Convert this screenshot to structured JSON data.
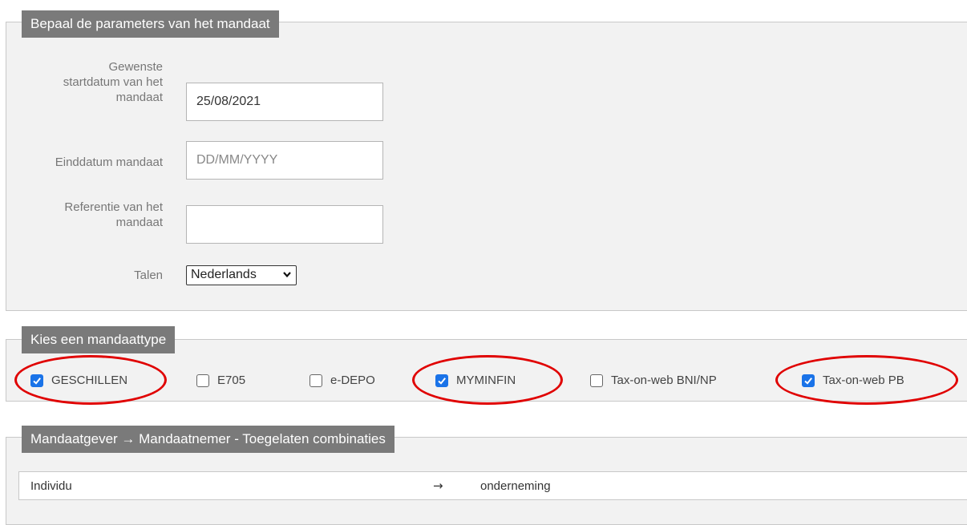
{
  "params": {
    "legend": "Bepaal de parameters van het mandaat",
    "start_label_1": "Gewenste",
    "start_label_2": "startdatum van het",
    "start_label_3": "mandaat",
    "start_value": "25/08/2021",
    "end_label": "Einddatum mandaat",
    "end_placeholder": "DD/MM/YYYY",
    "ref_label_1": "Referentie van het",
    "ref_label_2": "mandaat",
    "ref_value": "",
    "lang_label": "Talen",
    "lang_selected": "Nederlands"
  },
  "types": {
    "legend": "Kies een mandaattype",
    "items": [
      {
        "label": "GESCHILLEN",
        "checked": true
      },
      {
        "label": "E705",
        "checked": false
      },
      {
        "label": "e-DEPO",
        "checked": false
      },
      {
        "label": "MYMINFIN",
        "checked": true
      },
      {
        "label": "Tax-on-web BNI/NP",
        "checked": false
      },
      {
        "label": "Tax-on-web PB",
        "checked": true
      }
    ]
  },
  "combos": {
    "legend": "Mandaatgever → Mandaatnemer - Toegelaten combinaties",
    "row": {
      "from": "Individu",
      "arrow": "→",
      "to": "onderneming"
    }
  },
  "colors": {
    "checkbox_accent": "#1a73e8",
    "highlight": "#e00000",
    "legend_bg": "#7a7a7a"
  }
}
